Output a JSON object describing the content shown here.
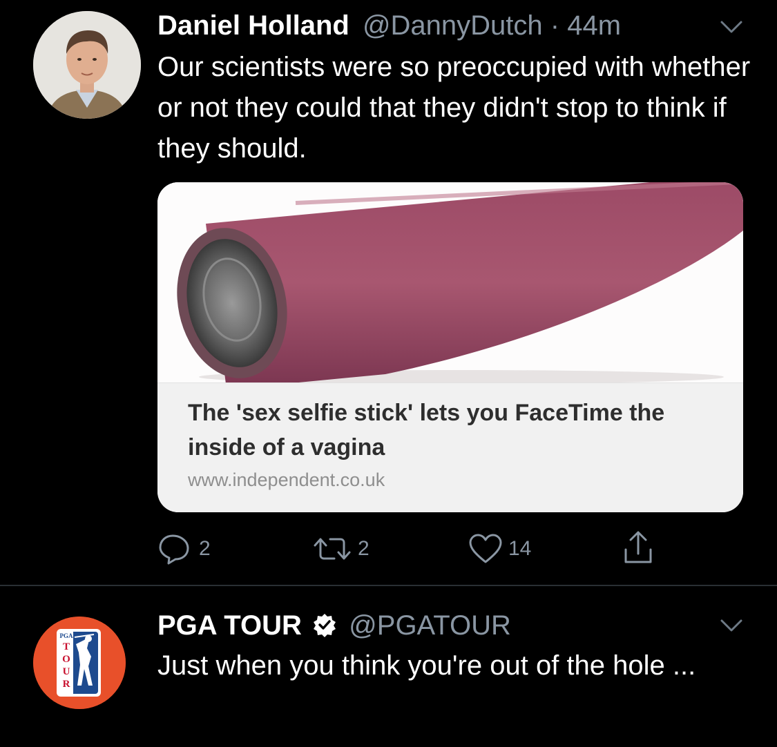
{
  "tweets": [
    {
      "display_name": "Daniel Holland",
      "handle": "@DannyDutch",
      "separator": "·",
      "time": "44m",
      "text": "Our scientists were so preoccupied with whether or not they could that they didn't stop to think if they should.",
      "link_card": {
        "title": "The 'sex selfie stick' lets you FaceTime the inside of a vagina",
        "url": "www.independent.co.uk"
      },
      "actions": {
        "replies": "2",
        "retweets": "2",
        "likes": "14"
      }
    },
    {
      "display_name": "PGA TOUR",
      "handle": "@PGATOUR",
      "verified": true,
      "text": "Just when you think you're out of the hole ...",
      "logo_text": {
        "top": "PGA",
        "vertical": "TOUR"
      }
    }
  ],
  "colors": {
    "background": "#000000",
    "muted": "#8a96a3",
    "pga_orange": "#e8502a",
    "pga_blue": "#1d4a8e"
  }
}
